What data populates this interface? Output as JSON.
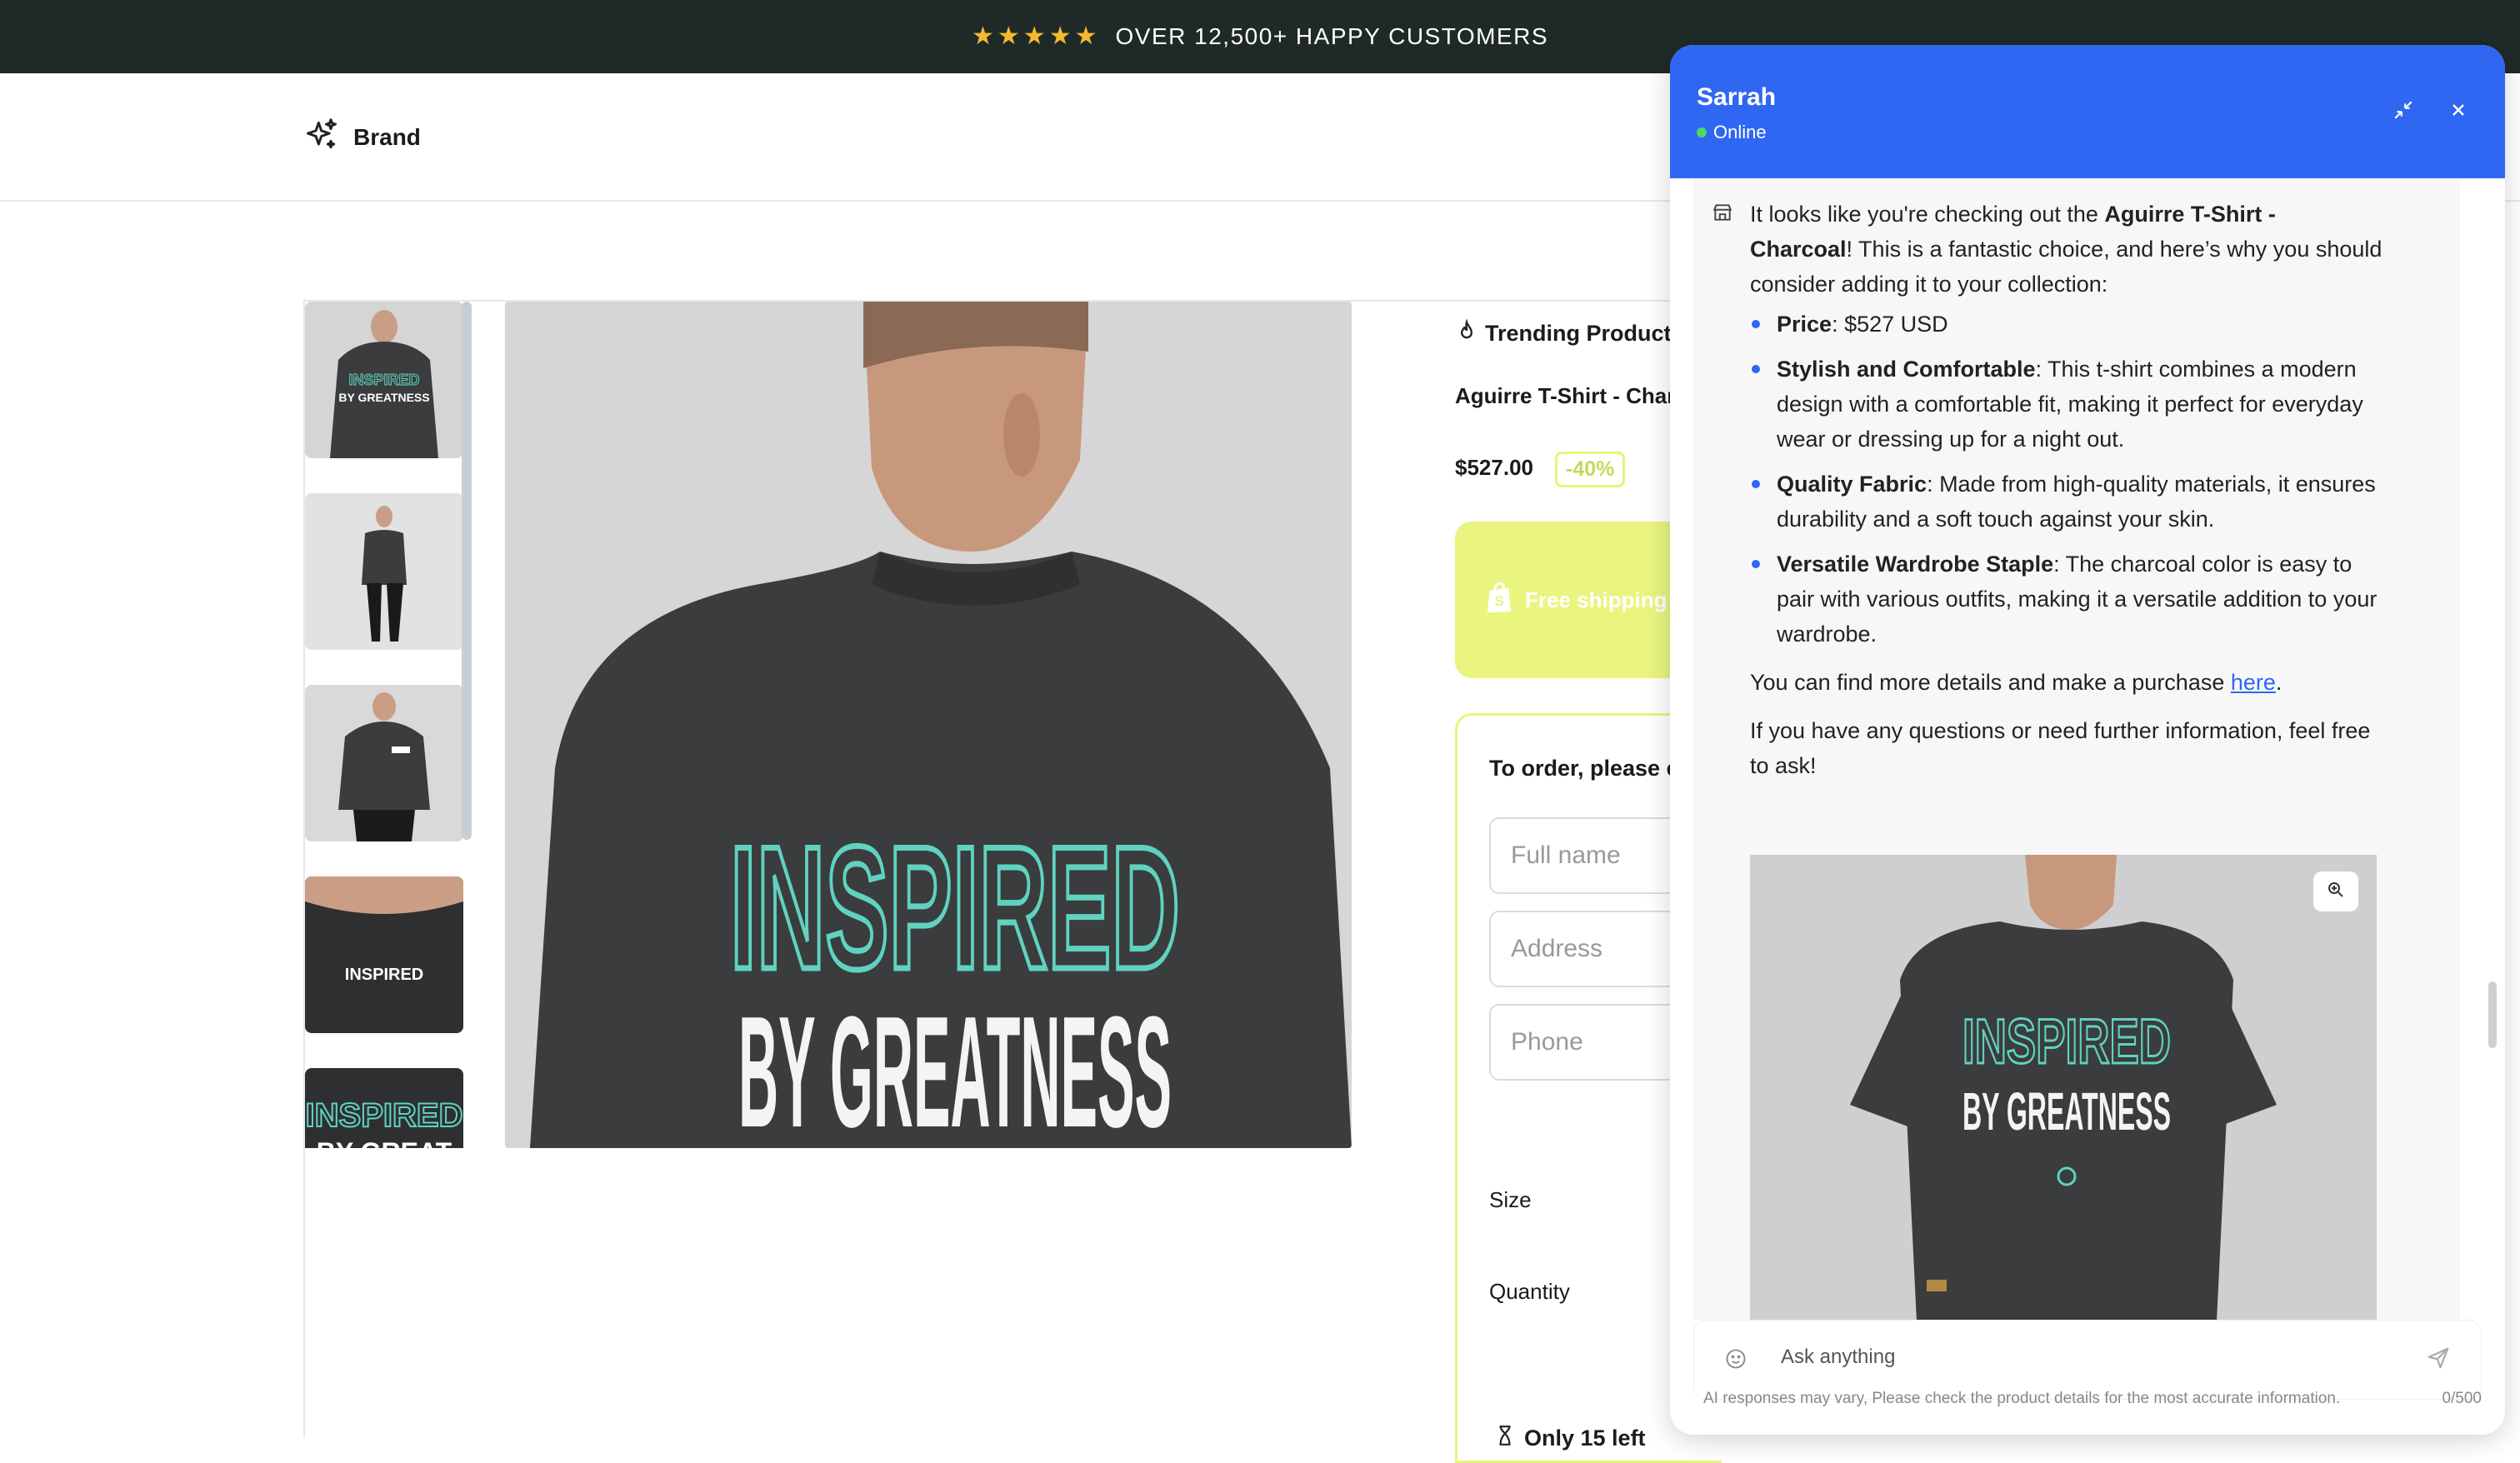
{
  "announcement": {
    "rating_stars": 5,
    "text": "OVER 12,500+ HAPPY CUSTOMERS"
  },
  "header": {
    "brand": "Brand"
  },
  "product": {
    "badge": "Trending Product",
    "title": "Aguirre T-Shirt - Charcoal",
    "price": "$527.00",
    "discount": "-40%",
    "shipping": "Free shipping on",
    "order_title": "To order, please enter",
    "fields": {
      "full_name_placeholder": "Full name",
      "address_placeholder": "Address",
      "phone_placeholder": "Phone"
    },
    "size_label": "Size",
    "quantity_label": "Quantity",
    "stock_text": "Only 15 left"
  },
  "chat": {
    "agent_name": "Sarrah",
    "status": "Online",
    "intro_pre": "It looks like you're checking out the ",
    "intro_bold": "Aguirre T-Shirt - Charcoal",
    "intro_post": "! This is a fantastic choice, and here’s why you should consider adding it to your collection:",
    "bullets": [
      {
        "bold": "Price",
        "text": ": $527 USD"
      },
      {
        "bold": "Stylish and Comfortable",
        "text": ": This t-shirt combines a modern design with a comfortable fit, making it perfect for everyday wear or dressing up for a night out."
      },
      {
        "bold": "Quality Fabric",
        "text": ": Made from high-quality materials, it ensures durability and a soft touch against your skin."
      },
      {
        "bold": "Versatile Wardrobe Staple",
        "text": ": The charcoal color is easy to pair with various outfits, making it a versatile addition to your wardrobe."
      }
    ],
    "find_pre": "You can find more details and make a purchase ",
    "find_link": "here",
    "find_post": ".",
    "closing": "If you have any questions or need further information, feel free to ask!",
    "image_text_top": "INSPIRED",
    "image_text_bottom": "BY GREATNESS",
    "input_placeholder": "Ask anything",
    "disclaimer": "AI responses may vary, Please check the product details for the most accurate information.",
    "char_count": "0/500"
  },
  "main_image": {
    "text_top": "INSPIRED",
    "text_bottom": "BY GREATNESS"
  },
  "colors": {
    "topbar": "#1f2a28",
    "chat_header": "#2f67f2",
    "accent_lime": "#e9f57f",
    "shirt": "#3b3c3e",
    "mint": "#5fd3bf"
  }
}
